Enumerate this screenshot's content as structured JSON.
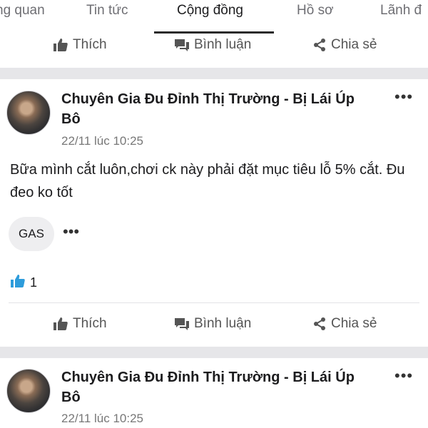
{
  "tabs": [
    {
      "label": "ng quan"
    },
    {
      "label": "Tin tức"
    },
    {
      "label": "Cộng đồng",
      "active": true
    },
    {
      "label": "Hồ sơ"
    },
    {
      "label": "Lãnh đ"
    }
  ],
  "actions": {
    "like_label": "Thích",
    "comment_label": "Bình luận",
    "share_label": "Chia sẻ"
  },
  "posts": [
    {
      "author": "Chuyên Gia Đu Đỉnh Thị Trường - Bị Lái Úp Bô",
      "timestamp": "22/11 lúc 10:25",
      "content": "Bữa mình cắt luôn,chơi ck này phải đặt mục tiêu lỗ 5% cắt. Đu đeo ko tốt",
      "tag": "GAS",
      "likes": "1"
    },
    {
      "author": "Chuyên Gia Đu Đỉnh Thị Trường - Bị Lái Úp Bô",
      "timestamp": "22/11 lúc 10:25"
    }
  ],
  "colors": {
    "like_accent": "#2d9cdb",
    "separator": "#e6e6e9"
  }
}
